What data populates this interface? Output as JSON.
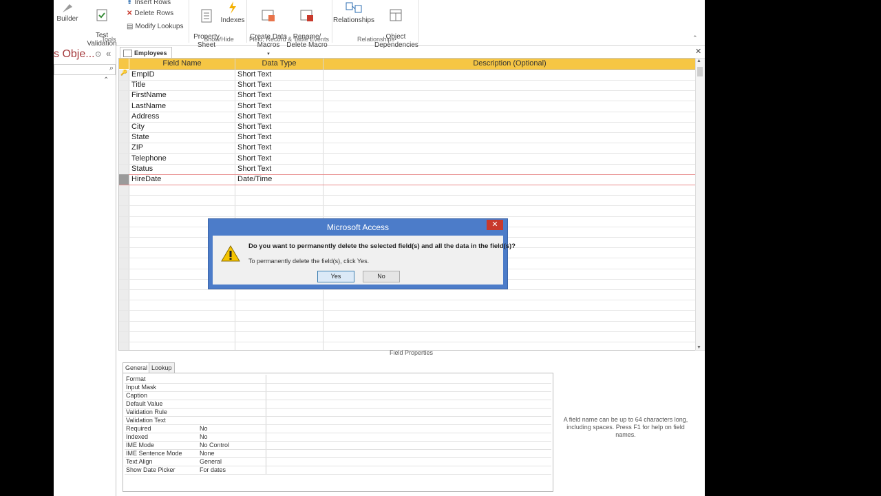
{
  "ribbon": {
    "tools": {
      "builder": "Builder",
      "test_validation": "Test Validation\nRules",
      "insert_rows": "Insert Rows",
      "delete_rows": "Delete Rows",
      "modify_lookups": "Modify Lookups",
      "group": "Tools"
    },
    "showhide": {
      "property_sheet": "Property\nSheet",
      "indexes": "Indexes",
      "group": "Show/Hide"
    },
    "events": {
      "create_data_macros": "Create Data\nMacros",
      "rename_delete_macro": "Rename/\nDelete Macro",
      "group": "Field, Record & Table Events"
    },
    "relationships": {
      "relationships": "Relationships",
      "object_dependencies": "Object\nDependencies",
      "group": "Relationships"
    }
  },
  "nav": {
    "title": "s Obje..."
  },
  "document": {
    "tab_label": "Employees"
  },
  "grid": {
    "headers": {
      "field_name": "Field Name",
      "data_type": "Data Type",
      "description": "Description (Optional)"
    },
    "rows": [
      {
        "field": "EmpID",
        "type": "Short Text",
        "key": true
      },
      {
        "field": "Title",
        "type": "Short Text"
      },
      {
        "field": "FirstName",
        "type": "Short Text"
      },
      {
        "field": "LastName",
        "type": "Short Text"
      },
      {
        "field": "Address",
        "type": "Short Text"
      },
      {
        "field": "City",
        "type": "Short Text"
      },
      {
        "field": "State",
        "type": "Short Text"
      },
      {
        "field": "ZIP",
        "type": "Short Text"
      },
      {
        "field": "Telephone",
        "type": "Short Text"
      },
      {
        "field": "Status",
        "type": "Short Text"
      },
      {
        "field": "HireDate",
        "type": "Date/Time",
        "selected": true
      }
    ]
  },
  "field_properties": {
    "label": "Field Properties",
    "tabs": [
      "General",
      "Lookup"
    ],
    "rows": [
      {
        "label": "Format",
        "value": ""
      },
      {
        "label": "Input Mask",
        "value": ""
      },
      {
        "label": "Caption",
        "value": ""
      },
      {
        "label": "Default Value",
        "value": ""
      },
      {
        "label": "Validation Rule",
        "value": ""
      },
      {
        "label": "Validation Text",
        "value": ""
      },
      {
        "label": "Required",
        "value": "No"
      },
      {
        "label": "Indexed",
        "value": "No"
      },
      {
        "label": "IME Mode",
        "value": "No Control"
      },
      {
        "label": "IME Sentence Mode",
        "value": "None"
      },
      {
        "label": "Text Align",
        "value": "General"
      },
      {
        "label": "Show Date Picker",
        "value": "For dates"
      }
    ],
    "help": "A field name can be up to 64 characters long, including spaces. Press F1 for help on field names."
  },
  "dialog": {
    "title": "Microsoft Access",
    "message": "Do you want to permanently delete the selected field(s) and all the data in the field(s)?",
    "sub": "To permanently delete the field(s), click Yes.",
    "yes": "Yes",
    "no": "No"
  },
  "colors": {
    "header_gold": "#f6c644",
    "dialog_blue": "#4c7cc9",
    "close_red": "#c8392c",
    "nav_title_red": "#a4373a"
  }
}
